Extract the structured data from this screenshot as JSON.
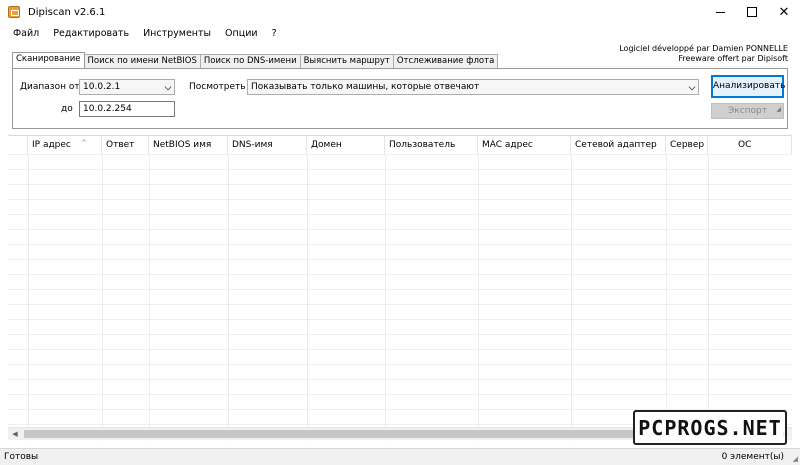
{
  "window": {
    "title": "Dipiscan v2.6.1"
  },
  "menu": [
    "Файл",
    "Редактировать",
    "Инструменты",
    "Опции",
    "?"
  ],
  "credits": [
    "Logiciel développé par Damien PONNELLE",
    "Freeware offert par Dipisoft"
  ],
  "tabs": [
    "Сканирование",
    "Поиск по имени NetBIOS",
    "Поиск по DNS-имени",
    "Выяснить маршрут",
    "Отслеживание флота"
  ],
  "scan": {
    "range_from_label": "Диапазон от",
    "range_from_value": "10.0.2.1",
    "range_to_label": "до",
    "range_to_value": "10.0.2.254",
    "view_label": "Посмотреть",
    "view_value": "Показывать только машины, которые отвечают",
    "analyze_button": "Анализировать",
    "export_button": "Экспорт"
  },
  "table": {
    "columns": [
      "IP адрес",
      "Ответ",
      "NetBIOS имя",
      "DNS-имя",
      "Домен",
      "Пользователь",
      "MAC адрес",
      "Сетевой адаптер",
      "Сервер",
      "ОС"
    ],
    "rows": []
  },
  "status": {
    "left": "Готовы",
    "right": "0 элемент(ы)"
  },
  "watermark": "PCPROGS.NET",
  "colors": {
    "accent": "#0078d7",
    "app_icon": "#e8a13a"
  }
}
